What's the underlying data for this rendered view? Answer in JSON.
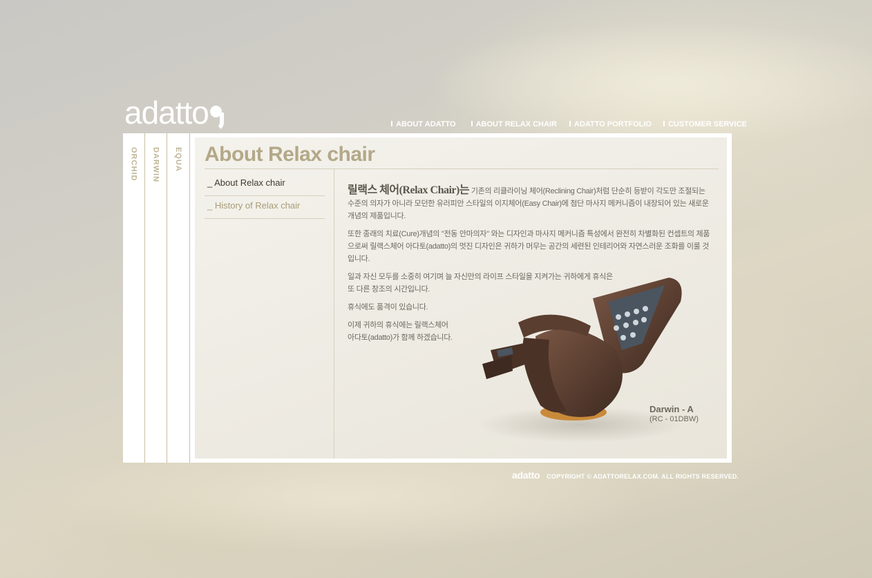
{
  "brand": {
    "logo_text": "adatto"
  },
  "topnav": [
    {
      "label": "ABOUT ADATTO"
    },
    {
      "label": "ABOUT RELAX CHAIR"
    },
    {
      "label": "ADATTO PORTFOLIO"
    },
    {
      "label": "CUSTOMER SERVICE"
    }
  ],
  "side_tabs": [
    {
      "label": "ORCHID"
    },
    {
      "label": "DARWIN"
    },
    {
      "label": "EQUA"
    }
  ],
  "page": {
    "title": "About Relax chair",
    "submenu": [
      {
        "label": "_ About Relax chair"
      },
      {
        "label": "_ History of Relax chair"
      }
    ],
    "lead": "릴랙스 체어(Relax Chair)는",
    "para1_rest": " 기존의 리클라이닝 체어(Reclining Chair)처럼 단순히 등받이 각도만 조절되는 수준의 의자가 아니라 모던한 유러피안 스타일의 이지체어(Easy Chair)에 첨단 마사지 메커니즘이 내장되어 있는 새로운 개념의 제품입니다.",
    "para2": "또한 종래의 치료(Cure)개념의 \"전동 안마의자\" 와는 디자인과 마사지 메커니즘 특성에서 완전히 차별화된 컨셉트의 제품으로써 릴랙스체어 아다토(adatto)의 멋진 디자인은 귀하가 머무는 공간의 세련된 인테리어와 자연스러운 조화를 이룰 것입니다.",
    "para3_line1": "일과 자신 모두를 소중히 여기며 늘 자신만의 라이프 스타일을 지켜가는 귀하에게 휴식은",
    "para3_line2": "또 다른 창조의 시간입니다.",
    "para4": "휴식에도 품격이 있습니다.",
    "para5_line1": "이제 귀하의 휴식에는 릴랙스체어",
    "para5_line2": "아다토(adatto)가 함께 하겠습니다."
  },
  "product": {
    "model": "Darwin - A",
    "code": "(RC - 01DBW)"
  },
  "footer": {
    "logo_text": "adatto",
    "copyright": "COPYRIGHT ©  ADATTORELAX.COM.  ALL RIGHTS RESERVED."
  },
  "colors": {
    "accent": "#b3a888",
    "submenu_inactive": "#a89c78",
    "chair_leather": "#5a3e30",
    "chair_base": "#c98a3a"
  }
}
